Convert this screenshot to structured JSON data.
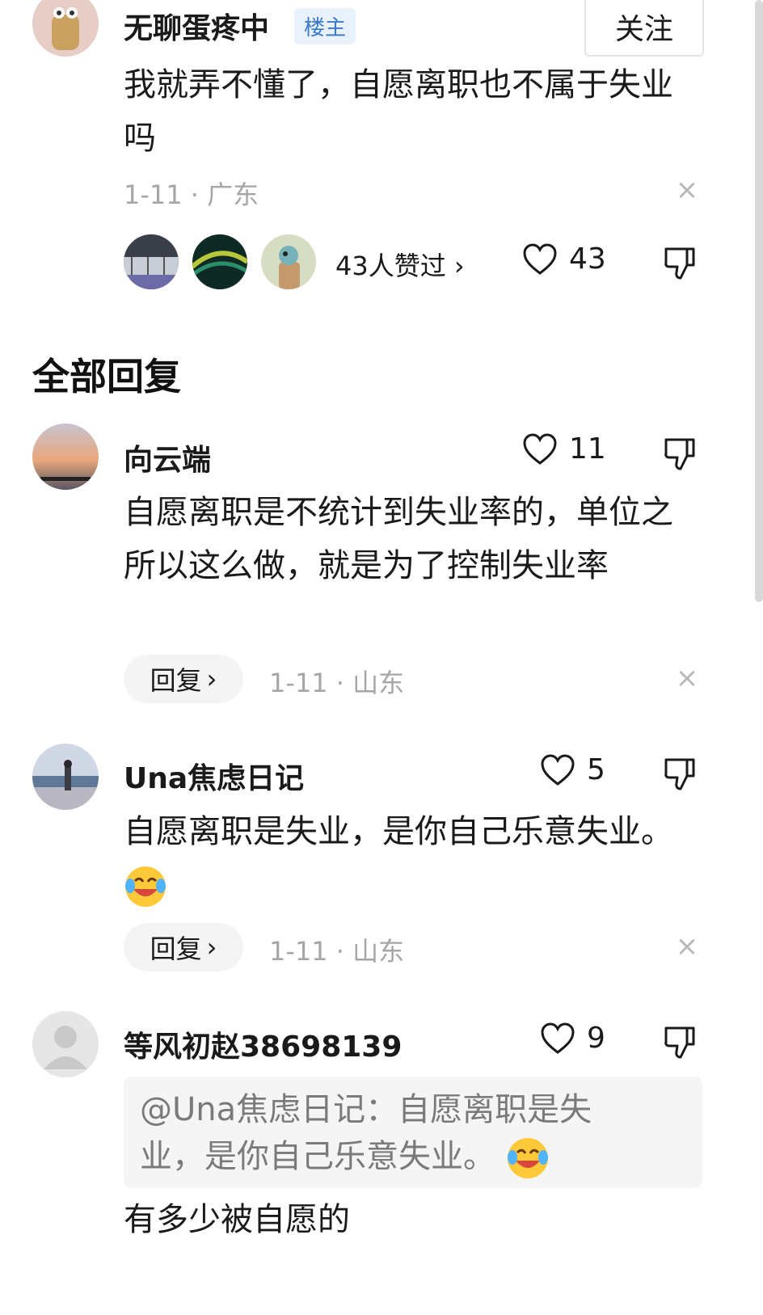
{
  "post": {
    "author": "无聊蛋疼中",
    "author_tag": "楼主",
    "follow_label": "关注",
    "content": "我就弄不懂了，自愿离职也不属于失业吗",
    "date": "1-11",
    "location": "广东",
    "likers_text": "43人赞过",
    "like_count": "43"
  },
  "section_title": "全部回复",
  "replies": [
    {
      "name": "向云端",
      "likes": "11",
      "content": "自愿离职是不统计到失业率的，单位之所以这么做，就是为了控制失业率",
      "reply_label": "回复",
      "date": "1-11",
      "location": "山东"
    },
    {
      "name": "Una焦虑日记",
      "likes": "5",
      "content": "自愿离职是失业，是你自己乐意失业。",
      "emoji": "laughing-crying-emoji",
      "reply_label": "回复",
      "date": "1-11",
      "location": "山东"
    },
    {
      "name": "等风初赵38698139",
      "likes": "9",
      "quote": "@Una焦虑日记：自愿离职是失业，是你自己乐意失业。",
      "content": "有多少被自愿的"
    }
  ],
  "separator": "·",
  "chevron": "›",
  "close_glyph": "×",
  "colors": {
    "tag_bg": "#e9f1fb",
    "tag_text": "#3a78c9",
    "meta": "#a6a6a6"
  }
}
